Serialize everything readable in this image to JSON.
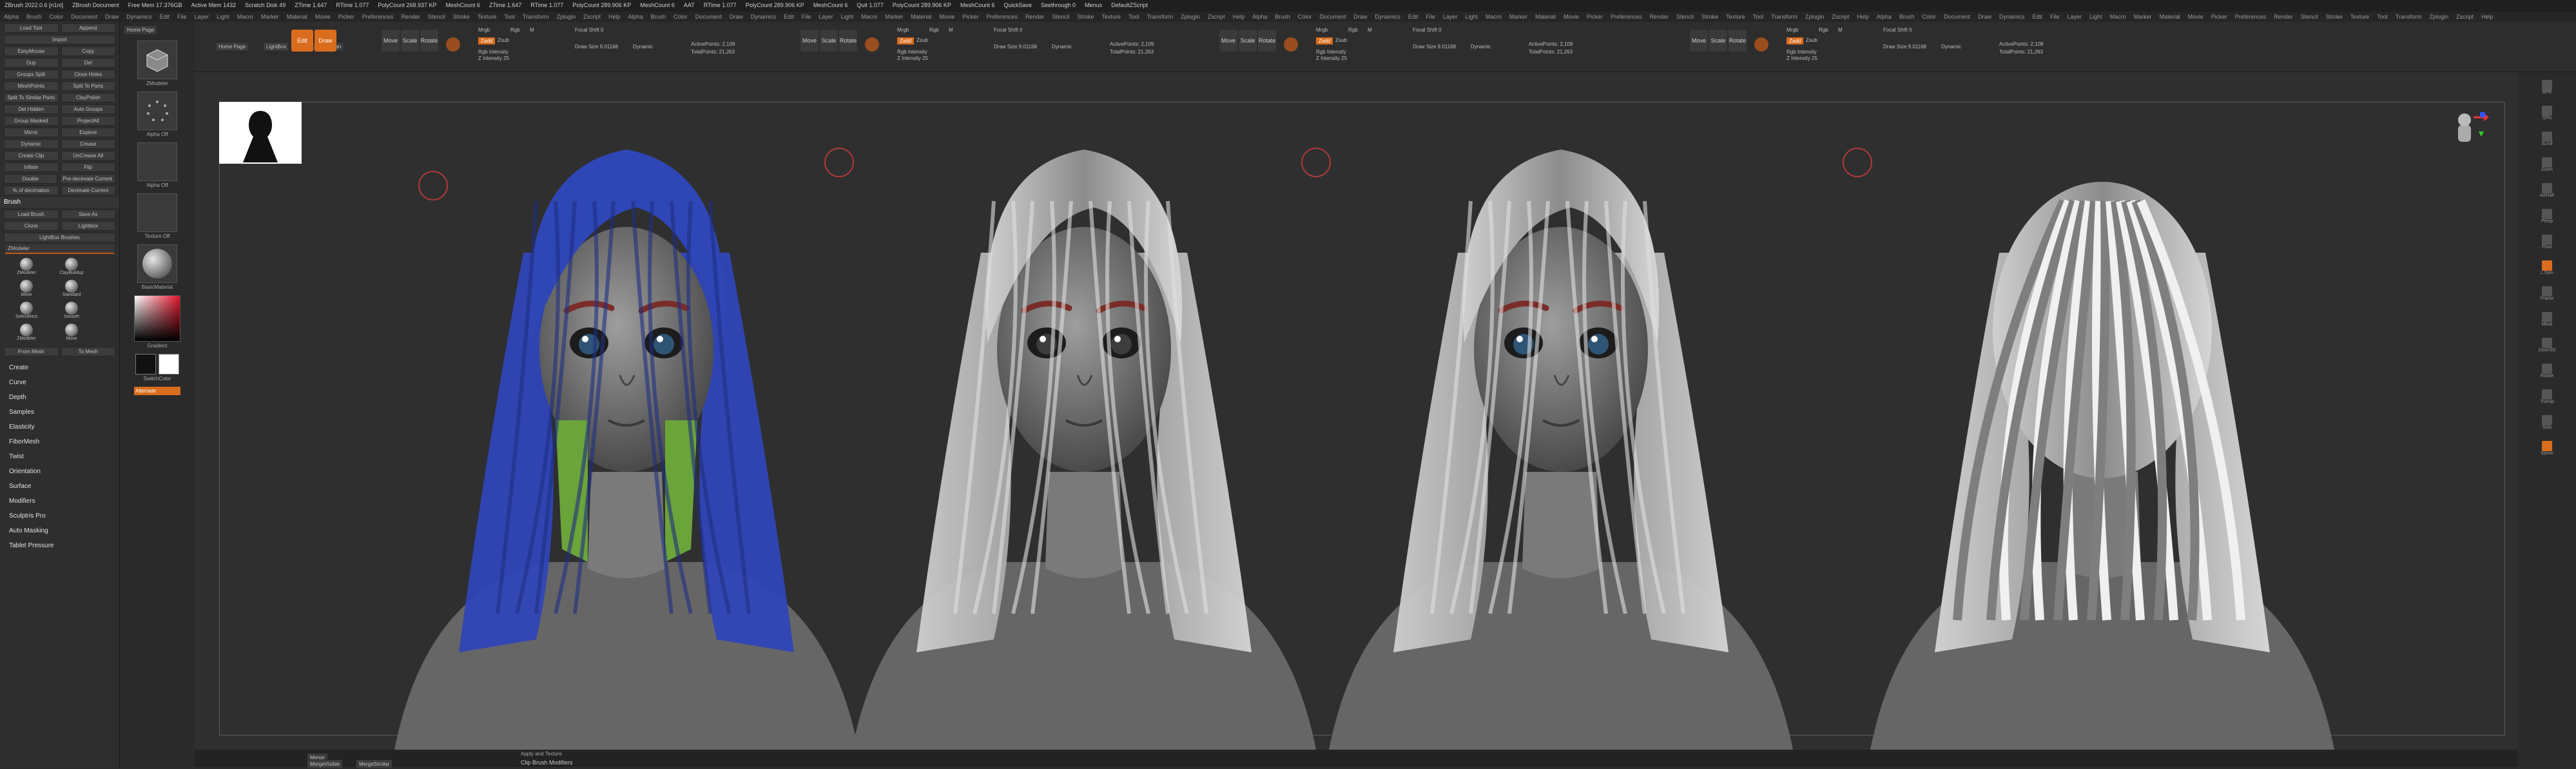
{
  "titlebar": [
    "ZBrush 2022.0.6 [n1ni]",
    "ZBrush Document",
    "Free Mem 17.376GB",
    "Active Mem 1432",
    "Scratch Disk 49",
    "ZTime 1.647",
    "RTime 1.077",
    "PolyCount 268.937 KP",
    "MeshCount 6",
    "ZTime 1.647",
    "RTime 1.077",
    "PolyCount 289.906 KP",
    "MeshCount 6",
    "AAT",
    "RTime 1.077",
    "PolyCount 289.906 KP",
    "MeshCount 6",
    "Quit 1.077",
    "PolyCount 289.906 KP",
    "MeshCount 6",
    "QuickSave",
    "Seethrough 0",
    "Menus",
    "DefaultZScript"
  ],
  "menus": [
    "Alpha",
    "Brush",
    "Color",
    "Document",
    "Draw",
    "Dynamics",
    "Edit",
    "File",
    "Layer",
    "Light",
    "Macro",
    "Marker",
    "Material",
    "Movie",
    "Picker",
    "Preferences",
    "Render",
    "Stencil",
    "Stroke",
    "Texture",
    "Tool",
    "Transform",
    "Zplugin",
    "Zscript",
    "Help"
  ],
  "left_tray": {
    "top_buttons": [
      "Load Tool",
      "Append",
      "Import"
    ],
    "subtool_labels": [
      "EasyMouse",
      "Copy",
      "Dup",
      "Del",
      "Groups Split",
      "Close Holes",
      "MeshPoints",
      "Split To Parts",
      "Split To Similar Parts",
      "ClayPolish",
      "Del Hidden",
      "Auto Groups",
      "Group Masked",
      "ProjectAll",
      "Mirror",
      "Explore",
      "Dynamic",
      "Crease",
      "Create Clip",
      "UnCrease All",
      "Inflate",
      "Flip",
      "Double",
      "Pre-decimate Current",
      "% of decimation",
      "Decimate Current"
    ],
    "brush_header": "Brush",
    "brush_buttons": [
      "Load Brush",
      "Save As",
      "Clone",
      "Lightbox",
      "LightBox Brushes",
      "ZModeler"
    ],
    "brushes": [
      "ZModeler",
      "ClayBuildup",
      "Move",
      "Standard",
      "SelectRect",
      "Smooth",
      "ZModeler",
      "Move"
    ],
    "brush_bottom": [
      "From Mesh",
      "To Mesh"
    ],
    "sub_menus": [
      "Create",
      "Curve",
      "Depth",
      "Samples",
      "Elasticity",
      "FiberMesh",
      "Twist",
      "Orientation",
      "Surface",
      "Modifiers",
      "Sculptris Pro",
      "Auto Masking",
      "Tablet Pressure"
    ]
  },
  "shelf": {
    "home": "Home Page",
    "lightbox": "LightBox",
    "live": "Live Boolean",
    "thumbs": [
      "ZModeler",
      "Alpha Off",
      "Texture Off",
      "BasicMaterial"
    ],
    "color_labels": [
      "Gradient",
      "SwitchColor",
      "Alternate"
    ]
  },
  "toolbar": {
    "edit": "Edit",
    "draw": "Draw",
    "move": "Move",
    "scale": "Scale",
    "rotate": "Rotate",
    "mrgb": "Mrgb",
    "rgb": "Rgb",
    "m": "M",
    "zadd": "Zadd",
    "zsub": "Zsub",
    "zcut": "Zcut",
    "focal": "Focal Shift 0",
    "drawsize": "Draw Size 9.01168",
    "dynamic": "Dynamic",
    "intensity": "Z Intensity 25",
    "rgbint": "Rgb Intensity",
    "activepoints": "ActivePoints: 2,109",
    "totalpoints": "TotalPoints: 21,263"
  },
  "bottom": {
    "merge": "Merge",
    "merge2": "MergeVisible",
    "merge3": "MergeSimilar",
    "mid": "Clip Brush Modifiers",
    "mid2": "Apply and Texture"
  },
  "right_icons": [
    "BPR",
    "SPix",
    "Scroll",
    "Zoom",
    "AAHalf",
    "Persp",
    "Floor",
    "L.Sym",
    "Frame",
    "Move",
    "Zoom3D",
    "Rotate",
    "Transp",
    "Solo",
    "Xpose"
  ],
  "colors": {
    "accent": "#d96d1d",
    "bg": "#2f2f2f",
    "hair_blue": "#2f46b7",
    "hair_green": "#6aa43a",
    "brow": "#7a2d28"
  }
}
